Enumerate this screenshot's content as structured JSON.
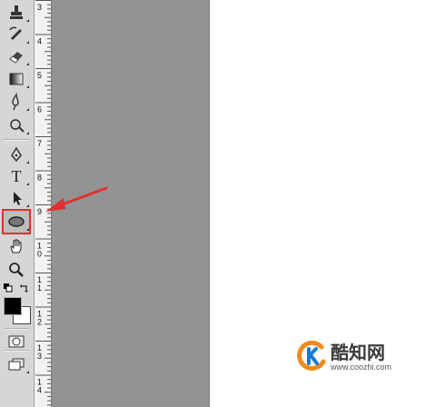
{
  "toolbar": {
    "tools": [
      {
        "name": "clone-stamp-tool"
      },
      {
        "name": "history-brush-tool"
      },
      {
        "name": "eraser-tool"
      },
      {
        "name": "gradient-tool"
      },
      {
        "name": "blur-tool"
      },
      {
        "name": "dodge-tool"
      },
      {
        "name": "pen-tool"
      },
      {
        "name": "type-tool",
        "glyph": "T"
      },
      {
        "name": "path-selection-tool"
      },
      {
        "name": "ellipse-shape-tool",
        "selected": true
      },
      {
        "name": "hand-tool"
      },
      {
        "name": "zoom-tool"
      }
    ],
    "foreground_color": "#000000",
    "background_color": "#ffffff"
  },
  "ruler": {
    "labels": [
      "3",
      "4",
      "5",
      "6",
      "7",
      "8",
      "9",
      "1\n0",
      "1\n1",
      "1\n2",
      "1\n3",
      "1\n4"
    ]
  },
  "highlight_color": "#e0302f",
  "watermark": {
    "name": "酷知网",
    "url": "www.coozhi.com"
  }
}
